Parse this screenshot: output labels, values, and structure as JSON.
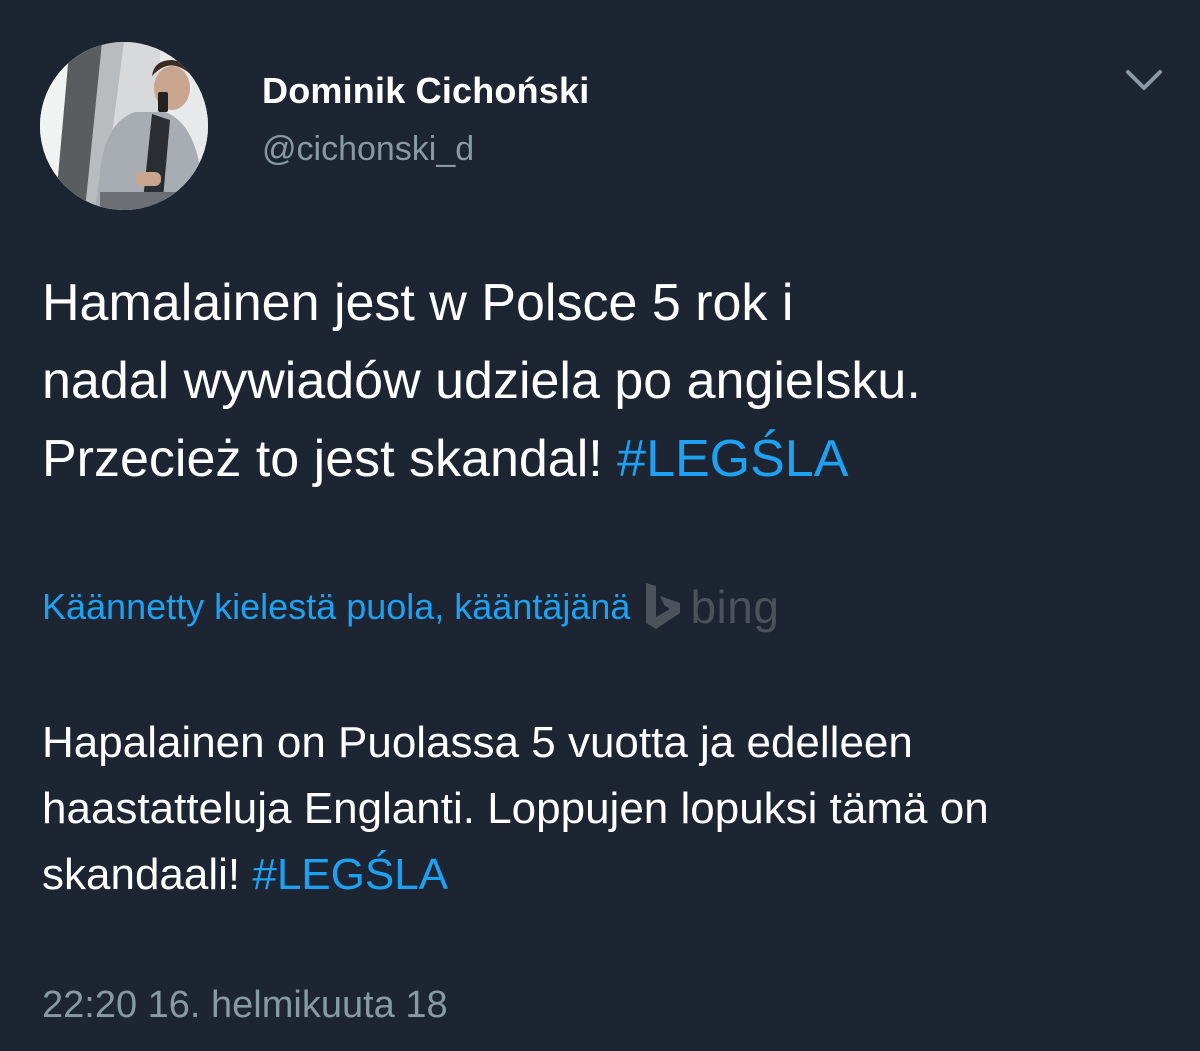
{
  "author": {
    "display_name": "Dominik Cichoński",
    "handle": "@cichonski_d",
    "avatar_icon": "profile-photo"
  },
  "tweet": {
    "text_lines": [
      "Hamalainen jest w Polsce 5 rok i",
      "nadal wywiadów udziela po angielsku.",
      "Przecież to jest skandal! "
    ],
    "hashtag": "#LEGŚLA"
  },
  "translation": {
    "label": "Käännetty kielestä puola, kääntäjänä",
    "provider": "bing",
    "provider_icon": "bing-logo-icon",
    "text_lines": [
      "Hapalainen on Puolassa 5 vuotta ja edelleen",
      "haastatteluja Englanti. Loppujen lopuksi tämä on",
      "skandaali! "
    ],
    "hashtag": "#LEGŚLA"
  },
  "meta": {
    "timestamp": "22:20 16. helmikuuta 18"
  },
  "menu_icon": "chevron-down-icon",
  "colors": {
    "background": "#1c2531",
    "link": "#1da1f2",
    "secondary_text": "#8899a6",
    "bing_gray": "#4b525a"
  }
}
